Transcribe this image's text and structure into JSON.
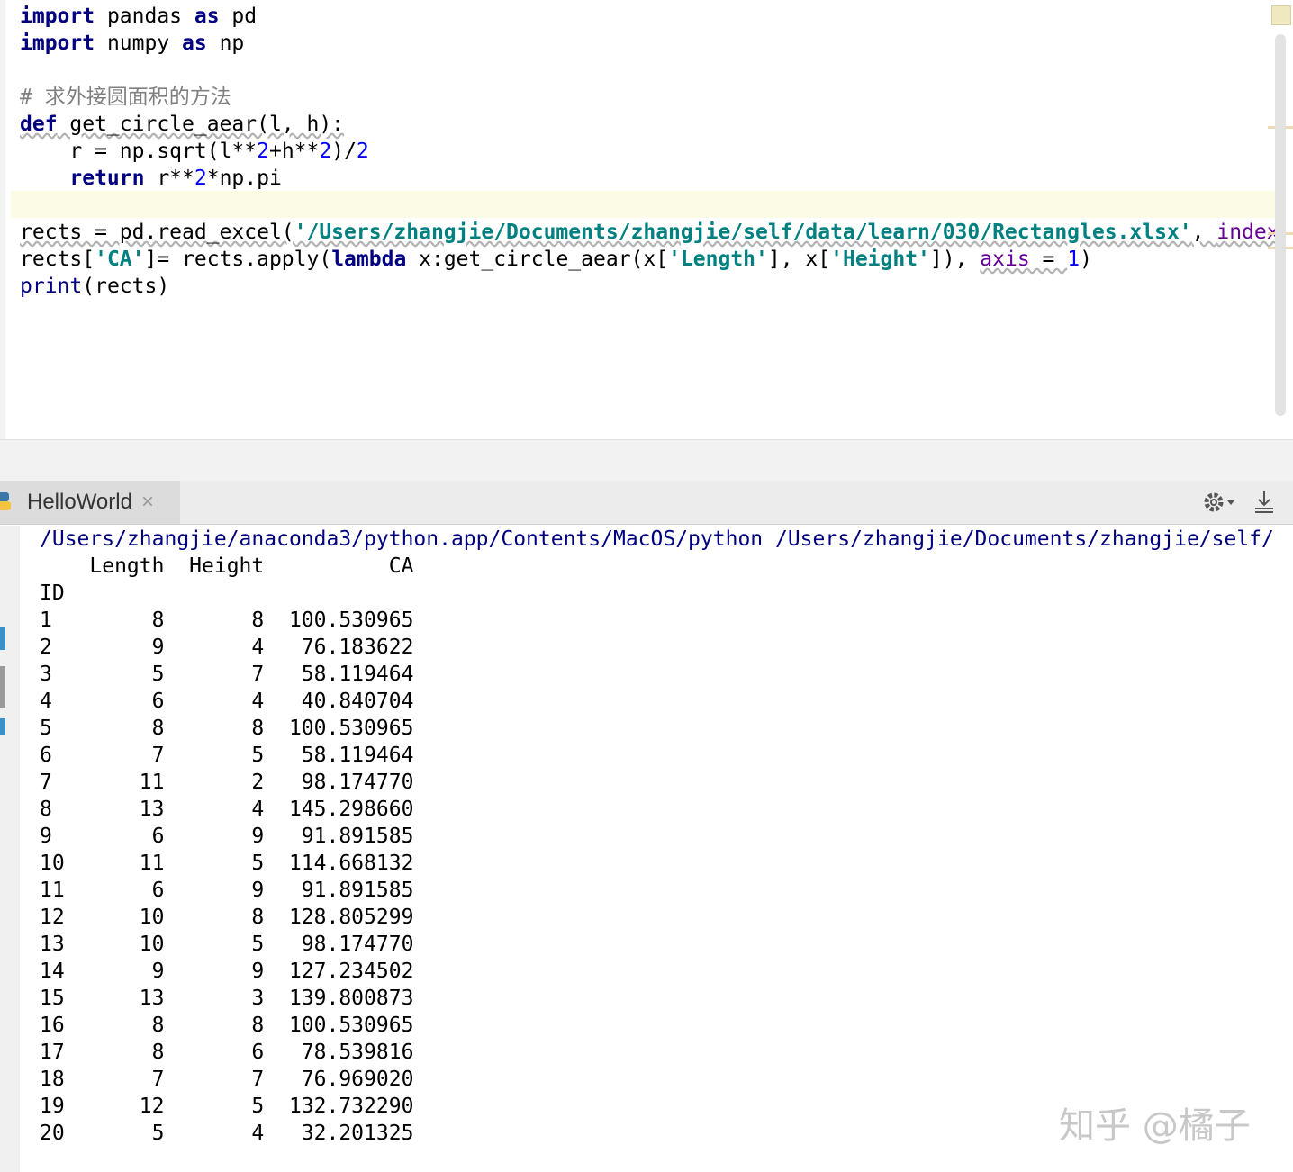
{
  "editor": {
    "lines": {
      "l1": {
        "kw": "import",
        "rest": " pandas ",
        "kw2": "as",
        "rest2": " pd"
      },
      "l2": {
        "kw": "import",
        "rest": " numpy ",
        "kw2": "as",
        "rest2": " np"
      },
      "l3": {
        "comment": "# 求外接圆面积的方法"
      },
      "l4": {
        "kw": "def",
        "rest": " get_circle_aear(l, h):"
      },
      "l5": {
        "a": "    r = np.sqrt(l**",
        "n1": "2",
        "b": "+h**",
        "n2": "2",
        "c": ")/",
        "n3": "2"
      },
      "l6": {
        "kw": "    return",
        "rest": " r**",
        "n1": "2",
        "rest2": "*np.pi"
      },
      "l7": {
        "a": "rects = pd.read_excel(",
        "str": "'/Users/zhangjie/Documents/zhangjie/self/data/learn/030/Rectangles.xlsx'",
        "b": ", ",
        "param": "index"
      },
      "l8": {
        "a": "rects[",
        "s1": "'CA'",
        "b": "]= rects.apply(",
        "kw": "lambda",
        "c": " x:get_circle_aear(x[",
        "s2": "'Length'",
        "d": "], x[",
        "s3": "'Height'",
        "e": "]), ",
        "param": "axis",
        "f": " = ",
        "n": "1",
        "g": ")"
      },
      "l9": {
        "fn": "print",
        "rest": "(rects)"
      }
    }
  },
  "run_panel": {
    "tab_label": "HelloWorld",
    "tab_close": "×"
  },
  "console": {
    "command": "/Users/zhangjie/anaconda3/python.app/Contents/MacOS/python /Users/zhangjie/Documents/zhangjie/self/",
    "header_line": "    Length  Height          CA",
    "index_label": "ID",
    "rows": [
      "1        8       8  100.530965",
      "2        9       4   76.183622",
      "3        5       7   58.119464",
      "4        6       4   40.840704",
      "5        8       8  100.530965",
      "6        7       5   58.119464",
      "7       11       2   98.174770",
      "8       13       4  145.298660",
      "9        6       9   91.891585",
      "10      11       5  114.668132",
      "11       6       9   91.891585",
      "12      10       8  128.805299",
      "13      10       5   98.174770",
      "14       9       9  127.234502",
      "15      13       3  139.800873",
      "16       8       8  100.530965",
      "17       8       6   78.539816",
      "18       7       7   76.969020",
      "19      12       5  132.732290",
      "20       5       4   32.201325"
    ]
  },
  "watermark": "知乎 @橘子",
  "icons": {
    "tab_icon": "python-icon",
    "settings": "gear-icon",
    "download": "download-icon"
  },
  "colors": {
    "keyword": "#000080",
    "number": "#0000ff",
    "string": "#008080",
    "comment": "#808080",
    "param": "#660099",
    "caret_line": "#fcfbe6"
  }
}
